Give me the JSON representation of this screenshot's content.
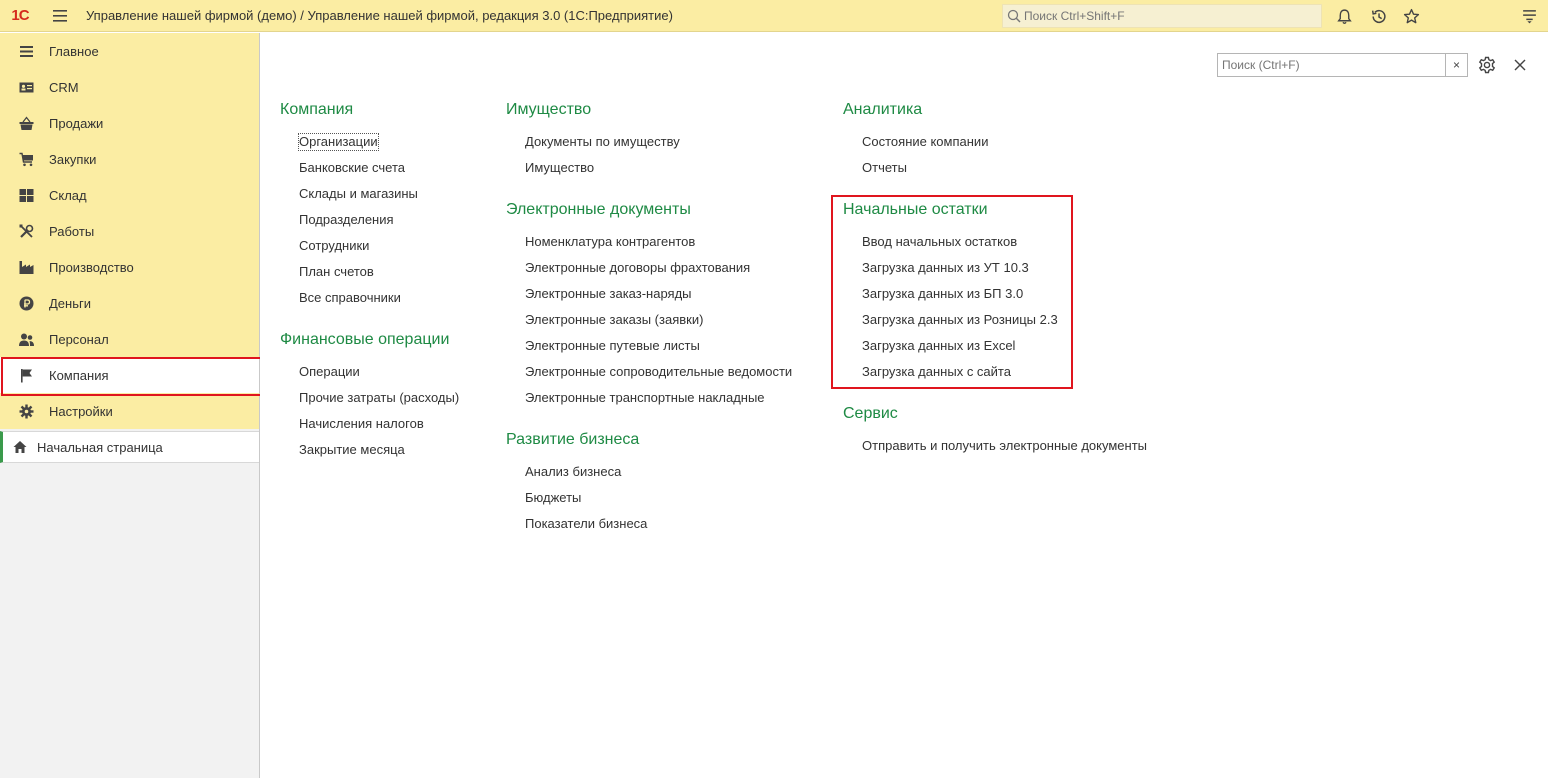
{
  "window": {
    "logo": "1С",
    "title": "Управление нашей фирмой (демо) / Управление нашей фирмой, редакция 3.0  (1С:Предприятие)",
    "search_placeholder": "Поиск Ctrl+Shift+F"
  },
  "sidebar": {
    "items": [
      {
        "label": "Главное",
        "icon": "hamburger-icon"
      },
      {
        "label": "CRM",
        "icon": "contact-card-icon"
      },
      {
        "label": "Продажи",
        "icon": "basket-icon"
      },
      {
        "label": "Закупки",
        "icon": "cart-icon"
      },
      {
        "label": "Склад",
        "icon": "boxes-icon"
      },
      {
        "label": "Работы",
        "icon": "tools-icon"
      },
      {
        "label": "Производство",
        "icon": "factory-icon"
      },
      {
        "label": "Деньги",
        "icon": "ruble-coin-icon"
      },
      {
        "label": "Персонал",
        "icon": "people-icon"
      },
      {
        "label": "Компания",
        "icon": "flag-icon"
      },
      {
        "label": "Настройки",
        "icon": "gear-icon"
      }
    ],
    "active_item": "Компания",
    "home_label": "Начальная страница"
  },
  "content": {
    "search_placeholder": "Поиск (Ctrl+F)",
    "clear_label": "×",
    "columns": [
      {
        "sections": [
          {
            "title": "Компания",
            "links": [
              "Организации",
              "Банковские счета",
              "Склады и магазины",
              "Подразделения",
              "Сотрудники",
              "План счетов",
              "Все справочники"
            ]
          },
          {
            "title": "Финансовые операции",
            "links": [
              "Операции",
              "Прочие затраты (расходы)",
              "Начисления налогов",
              "Закрытие месяца"
            ]
          }
        ]
      },
      {
        "sections": [
          {
            "title": "Имущество",
            "links": [
              "Документы по имуществу",
              "Имущество"
            ]
          },
          {
            "title": "Электронные документы",
            "links": [
              "Номенклатура контрагентов",
              "Электронные договоры фрахтования",
              "Электронные заказ-наряды",
              "Электронные заказы (заявки)",
              "Электронные путевые листы",
              "Электронные сопроводительные ведомости",
              "Электронные транспортные накладные"
            ]
          },
          {
            "title": "Развитие бизнеса",
            "links": [
              "Анализ бизнеса",
              "Бюджеты",
              "Показатели бизнеса"
            ]
          }
        ]
      },
      {
        "sections": [
          {
            "title": "Аналитика",
            "links": [
              "Состояние компании",
              "Отчеты"
            ]
          },
          {
            "title": "Начальные остатки",
            "links": [
              "Ввод начальных остатков",
              "Загрузка данных из УТ 10.3",
              "Загрузка данных из БП 3.0",
              "Загрузка данных из Розницы 2.3",
              "Загрузка данных из Excel",
              "Загрузка данных с сайта"
            ]
          },
          {
            "title": "Сервис",
            "links": [
              "Отправить и получить электронные документы"
            ]
          }
        ]
      }
    ],
    "focused_link": "Организации"
  },
  "colors": {
    "titlebar_bg": "#fbeda3",
    "section_green": "#1e8a44",
    "highlight_red": "#e0151e"
  }
}
